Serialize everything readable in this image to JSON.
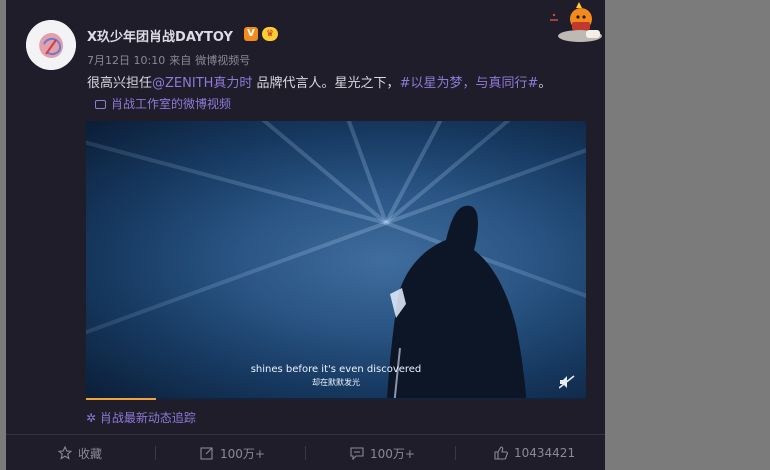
{
  "post": {
    "username": "X玖少年团肖战DAYTOY",
    "verified_badge": "V",
    "meta": {
      "date": "7月12日 10:10",
      "source_prefix": "来自",
      "source": "微博视频号"
    },
    "text_plain": "很高兴担任",
    "text_mention": "@ZENITH真力时",
    "text_middle": " 品牌代言人。星光之下，",
    "text_hashtag": "#以星为梦，与真同行#",
    "text_end": "。",
    "video_link": "肖战工作室的微博视频"
  },
  "video": {
    "subtitle_en": "shines before it's even discovered",
    "subtitle_cn": "却在默默发光",
    "progress": 0.14
  },
  "follow_link": "肖战最新动态追踪",
  "actions": {
    "favorite": "收藏",
    "repost": "100万+",
    "comment": "100万+",
    "like": "10434421"
  },
  "icons": [
    "star-icon",
    "repost-icon",
    "comment-icon",
    "like-icon",
    "video-icon",
    "mute-icon",
    "loading-icon"
  ],
  "colors": {
    "link": "#8f7ad8",
    "card_bg": "#1f1d29",
    "progress": "#f0a43a"
  }
}
